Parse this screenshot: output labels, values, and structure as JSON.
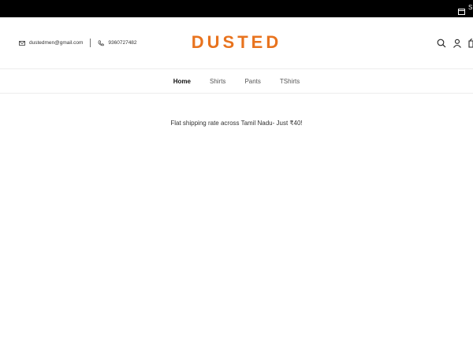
{
  "topbar": {
    "text": "S",
    "icon": "calendar-icon"
  },
  "header": {
    "email": "dustedmen@gmail.com",
    "phone": "9360727482",
    "logo": "DUSTED",
    "brand_color": "#e8731e",
    "icons": [
      "search-icon",
      "account-icon",
      "cart-icon"
    ]
  },
  "nav": {
    "items": [
      {
        "label": "Home"
      },
      {
        "label": "Shirts"
      },
      {
        "label": "Pants"
      },
      {
        "label": "TShirts"
      }
    ],
    "active": "Home"
  },
  "announcement": {
    "text": "Flat shipping rate across Tamil Nadu- Just ₹40!"
  }
}
